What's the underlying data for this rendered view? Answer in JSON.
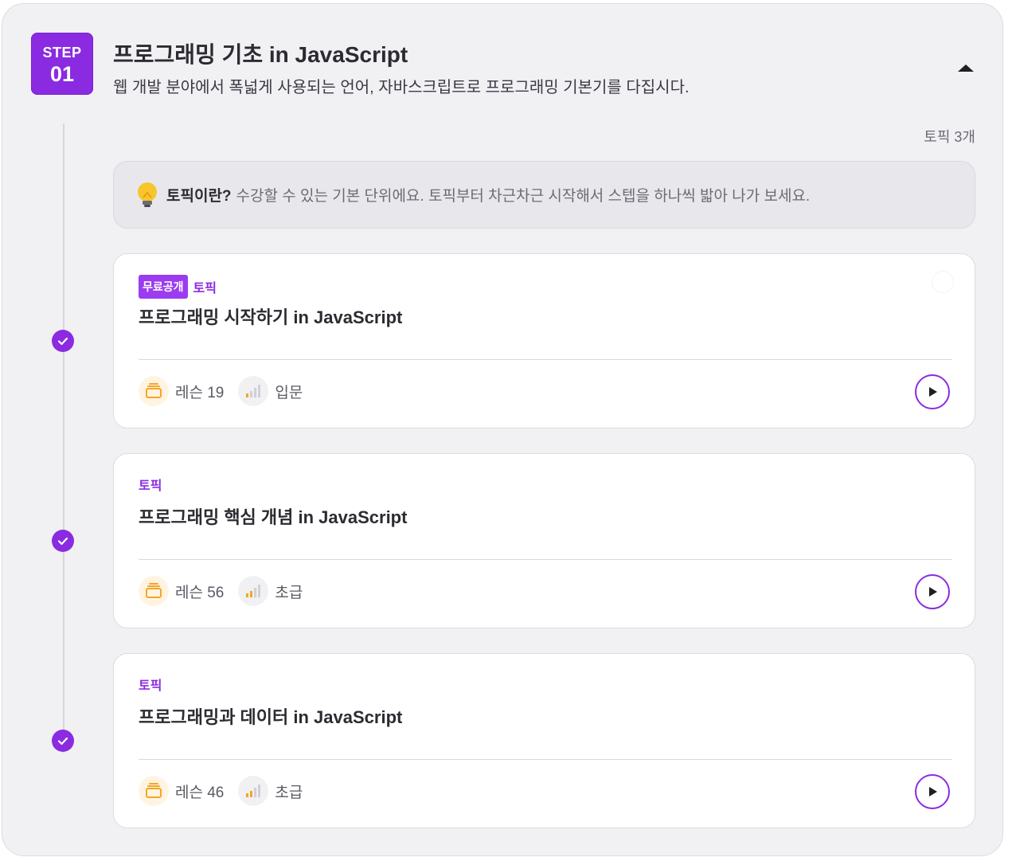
{
  "step": {
    "label": "STEP",
    "number": "01",
    "title": "프로그래밍 기초 in JavaScript",
    "description": "웹 개발 분야에서 폭넓게 사용되는 언어, 자바스크립트로 프로그래밍 기본기를 다집시다.",
    "collapse_icon": "caret-up-icon"
  },
  "topic_count": "토픽 3개",
  "info": {
    "icon": "lightbulb-icon",
    "strong": "토픽이란?",
    "text": "수강할 수 있는 기본 단위에요. 토픽부터 차근차근 시작해서 스텝을 하나씩 밟아 나가 보세요."
  },
  "topics": [
    {
      "free_label": "무료공개",
      "tag": "토픽",
      "title": "프로그래밍 시작하기 in JavaScript",
      "lessons": "레슨 19",
      "level": "입문",
      "completed": true
    },
    {
      "free_label": "",
      "tag": "토픽",
      "title": "프로그래밍 핵심 개념 in JavaScript",
      "lessons": "레슨 56",
      "level": "초급",
      "completed": true
    },
    {
      "free_label": "",
      "tag": "토픽",
      "title": "프로그래밍과 데이터 in JavaScript",
      "lessons": "레슨 46",
      "level": "초급",
      "completed": true
    }
  ],
  "colors": {
    "accent": "#8a2be2",
    "lesson_icon": "#f5a623",
    "level_bar_active": "#f5a623",
    "level_bar_inactive": "#d0d0d6"
  }
}
